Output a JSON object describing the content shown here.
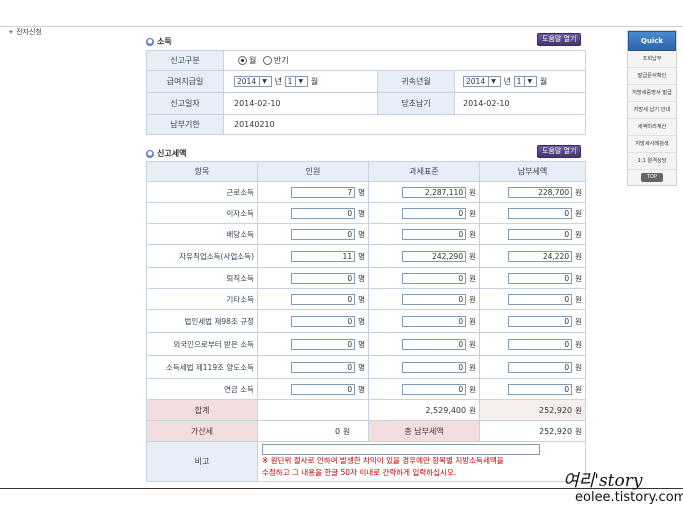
{
  "breadcrumb": "+ 전자신청",
  "section1": {
    "title": "소득",
    "help_label": "도움말 열기"
  },
  "form": {
    "report_type_label": "신고구분",
    "report_type_options": [
      "월",
      "반기"
    ],
    "pay_date_label": "급여지급일",
    "pay_year": "2014",
    "pay_month": "1",
    "year_unit": "년",
    "month_unit": "월",
    "attr_month_label": "귀속년월",
    "attr_year": "2014",
    "attr_month": "1",
    "report_date_label": "신고일자",
    "report_date": "2014-02-10",
    "original_due_label": "당초납기",
    "original_due": "2014-02-10",
    "payment_due_label": "납부기한",
    "payment_due": "20140210"
  },
  "section2": {
    "title": "신고세액",
    "help_label": "도움말 열기"
  },
  "tax_table": {
    "headers": [
      "항목",
      "인원",
      "과세표준",
      "납부세액"
    ],
    "person_unit": "명",
    "won_unit": "원",
    "rows": [
      {
        "item": "근로소득",
        "people": "7",
        "base": "2,287,110",
        "tax": "228,700"
      },
      {
        "item": "이자소득",
        "people": "0",
        "base": "0",
        "tax": "0"
      },
      {
        "item": "배당소득",
        "people": "0",
        "base": "0",
        "tax": "0"
      },
      {
        "item": "자유직업소득(사업소득)",
        "people": "11",
        "base": "242,290",
        "tax": "24,220"
      },
      {
        "item": "퇴직소득",
        "people": "0",
        "base": "0",
        "tax": "0"
      },
      {
        "item": "기타소득",
        "people": "0",
        "base": "0",
        "tax": "0"
      },
      {
        "item": "법인세법 제98조 규정",
        "people": "0",
        "base": "0",
        "tax": "0"
      },
      {
        "item": "외국인으로부터 받은 소득",
        "people": "0",
        "base": "0",
        "tax": "0"
      },
      {
        "item": "소득세법 제119조 양도소득",
        "people": "0",
        "base": "0",
        "tax": "0"
      },
      {
        "item": "연금 소득",
        "people": "0",
        "base": "0",
        "tax": "0"
      }
    ],
    "total_label": "합계",
    "total_base": "2,529,400",
    "total_tax": "252,920",
    "penalty_label": "가산세",
    "penalty_value": "0",
    "grand_total_label": "총 납부세액",
    "grand_total": "252,920",
    "remark_label": "비고",
    "remark_note_1": "※ 원단위 절사로 인하여 발생한 차익이 있을 경우에만 항목별 지방소득세액을",
    "remark_note_2": "수정하고 그 내용을 한글 50자 이내로 간략하게 입력하십시오."
  },
  "quick_menu": {
    "title": "Quick Menu",
    "items": [
      "조회납부",
      "발급문서확인",
      "지방세증명서 발급",
      "지방세 납기 안내",
      "세액미리계산",
      "지방세사례검색",
      "1:1 원격상담"
    ],
    "top_label": "TOP"
  },
  "watermark": {
    "line1": "여리'story",
    "line2": "eolee.tistory.com"
  },
  "colors": {
    "header_bg": "#e8eef7",
    "total_bg": "#f2dede",
    "note_red": "#c40000",
    "help_btn": "#45336d",
    "quick_menu": "#2d63a8"
  }
}
